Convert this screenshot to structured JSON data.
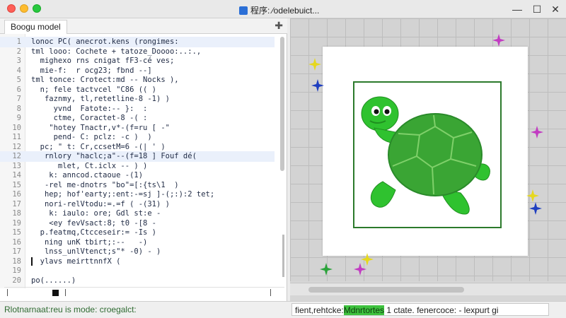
{
  "window": {
    "title": "程序: ⁄odelebuict..."
  },
  "editor": {
    "tab_label": "Boogu model",
    "add_tab_icon": "plus-icon",
    "lines": [
      {
        "n": "1",
        "text": "lonoc PC( anecrot.kens (rongimes:"
      },
      {
        "n": "2",
        "text": "tml looo: Cochete + tatoze_Doooo:..:.,"
      },
      {
        "n": "3",
        "text": "  mighexo rns cnigat fF3-cé ves;"
      },
      {
        "n": "4",
        "text": "  mie-f:  r ocg23; fbnd --]"
      },
      {
        "n": "5",
        "text": "tml tonce: Crotect:md -- Nocks ),"
      },
      {
        "n": "6",
        "text": "  n; fele tactvcel \"C86 (( )"
      },
      {
        "n": "7",
        "text": "   faznmy, tl,retetline-8 -1) )"
      },
      {
        "n": "8",
        "text": "     yvnd  Fatote:-- }:  :"
      },
      {
        "n": "9",
        "text": "     ctme, Coractet-8 -( :"
      },
      {
        "n": "10",
        "text": "    \"hotey Tnactr,v*-(f=ru [ -\""
      },
      {
        "n": "11",
        "text": "     pend- C: pclz: -c )  )"
      },
      {
        "n": "12",
        "text": "  pc; \" t: Cr,ccsetM=6 -(| ' )"
      },
      {
        "n": "12",
        "text": "   rnlory \"haclc;a\"--(f=18 ] Fouf dé("
      },
      {
        "n": "13",
        "text": "      mlet, Ct.iclx -- ) )"
      },
      {
        "n": "14",
        "text": "    k: anncod.ctaoue -(1)"
      },
      {
        "n": "15",
        "text": "   -rel me-dnotrs \"bo\"=[:{ts\\1  )"
      },
      {
        "n": "16",
        "text": "   hep; hof'earty;:ent:-=sj ]-(;:):2 tet;"
      },
      {
        "n": "17",
        "text": "   nori-relVtodu:=.=f ( -(31) )"
      },
      {
        "n": "18",
        "text": "    k: iaulo: ore; Gdl st:e -"
      },
      {
        "n": "19",
        "text": "    <ey fevVsact:8; t0 -[8 -"
      },
      {
        "n": "15",
        "text": "  p.featmq,Ctcceseir:= -Is )"
      },
      {
        "n": "16",
        "text": "   ning unK tbirt;:--   -)"
      },
      {
        "n": "17",
        "text": "   lnss_unlVtenct;s\"* -0) - )"
      },
      {
        "n": "18",
        "text": "  ylavs meirttnnfX ("
      },
      {
        "n": "19",
        "text": ""
      },
      {
        "n": "20",
        "text": "po(......)"
      }
    ],
    "active_line_indexes": [
      0,
      12
    ]
  },
  "canvas": {
    "turtle_colors": {
      "shell": "#3aa534",
      "shell_dark": "#2a8a2a",
      "body": "#2fc22f",
      "frame": "#2c7a2c"
    },
    "sprites": [
      {
        "icon": "star-sprite-icon",
        "color": "#c23cc2"
      },
      {
        "icon": "star-sprite-icon",
        "color": "#e6d81e"
      },
      {
        "icon": "star-sprite-icon",
        "color": "#1f3fc0"
      },
      {
        "icon": "star-sprite-icon",
        "color": "#c23cc2"
      },
      {
        "icon": "star-sprite-icon",
        "color": "#e6d81e"
      },
      {
        "icon": "star-sprite-icon",
        "color": "#1f3fc0"
      },
      {
        "icon": "star-sprite-icon",
        "color": "#2aa33a"
      },
      {
        "icon": "star-sprite-icon",
        "color": "#c23cc2"
      },
      {
        "icon": "star-sprite-icon",
        "color": "#e6d81e"
      }
    ]
  },
  "status": {
    "left": "Rlotnarnaat:reu is mode: croegalct:",
    "right_prefix": "fient,rehtcke:",
    "right_highlight": "Mdnrtortes",
    "right_suffix": " 1 ctate. fenercoce: - lexpurt gi"
  }
}
